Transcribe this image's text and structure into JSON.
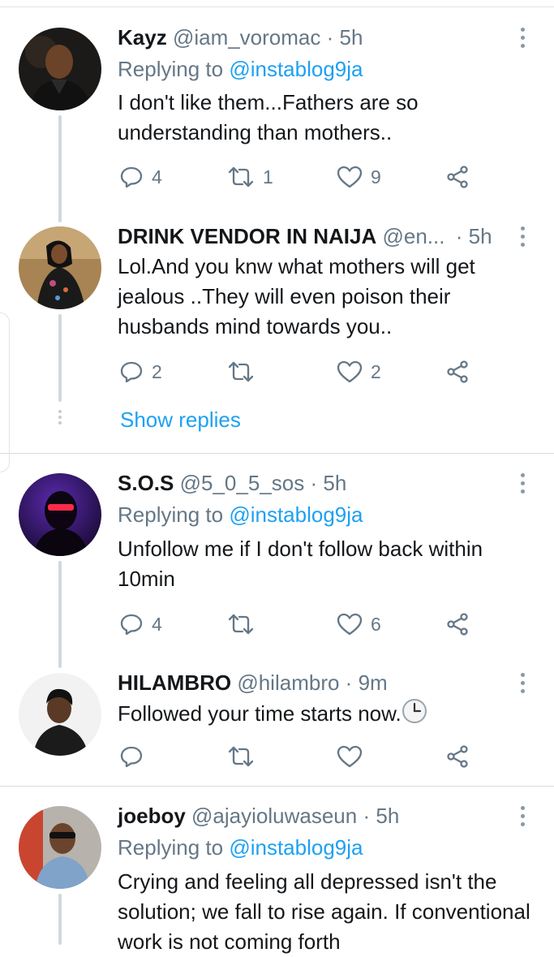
{
  "tweets": [
    {
      "name": "Kayz",
      "handle": "@iam_voromac",
      "time": "5h",
      "replying_label": "Replying to",
      "replying_to": "@instablog9ja",
      "text": "I don't like them...Fathers are so understanding than mothers..",
      "replies": "4",
      "retweets": "1",
      "likes": "9"
    },
    {
      "name": "DRINK VENDOR IN NAIJA",
      "handle": "@en...",
      "time": "5h",
      "text": "Lol.And you knw what  mothers will get jealous ..They will even poison their husbands  mind towards you..",
      "replies": "2",
      "retweets": "",
      "likes": "2",
      "show_replies": "Show replies"
    },
    {
      "name": "S.O.S",
      "handle": "@5_0_5_sos",
      "time": "5h",
      "replying_label": "Replying to",
      "replying_to": "@instablog9ja",
      "text": "Unfollow me if I don't follow back within 10min",
      "replies": "4",
      "retweets": "",
      "likes": "6"
    },
    {
      "name": "HILAMBRO",
      "handle": "@hilambro",
      "time": "9m",
      "text": "Followed your time starts now.",
      "emoji": "🕒",
      "replies": "",
      "retweets": "",
      "likes": ""
    },
    {
      "name": "joeboy",
      "handle": "@ajayioluwaseun",
      "time": "5h",
      "replying_label": "Replying to",
      "replying_to": "@instablog9ja",
      "text": "Crying and feeling all depressed isn't the solution; we fall to rise again. If conventional work is not coming forth"
    }
  ],
  "separator": "·",
  "icons": {
    "reply": "reply-icon",
    "retweet": "retweet-icon",
    "like": "heart-icon",
    "share": "share-icon",
    "more": "more-vertical-icon"
  },
  "colors": {
    "accent": "#1da1f2",
    "secondary_text": "#657786",
    "primary_text": "#14171a",
    "divider": "#d7dbdf"
  }
}
